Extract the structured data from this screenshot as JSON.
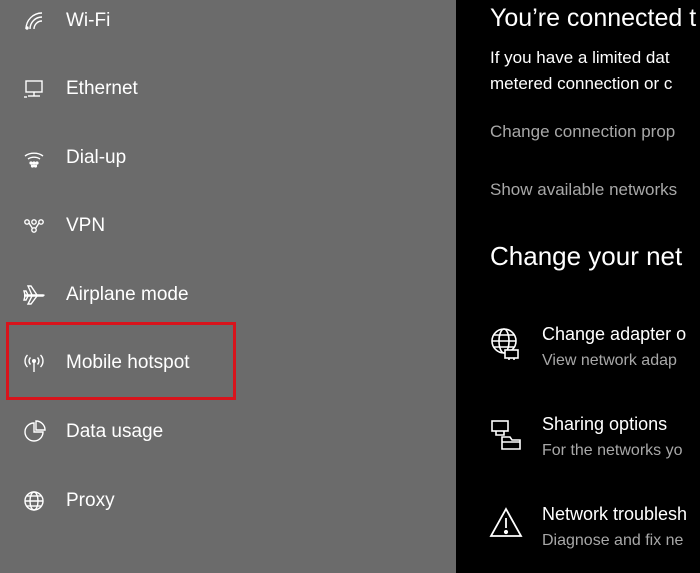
{
  "sidebar": {
    "items": [
      {
        "label": "Wi-Fi",
        "icon": "wifi-icon"
      },
      {
        "label": "Ethernet",
        "icon": "ethernet-icon"
      },
      {
        "label": "Dial-up",
        "icon": "dial-up-icon"
      },
      {
        "label": "VPN",
        "icon": "vpn-icon"
      },
      {
        "label": "Airplane mode",
        "icon": "airplane-icon"
      },
      {
        "label": "Mobile hotspot",
        "icon": "hotspot-icon",
        "highlighted": true
      },
      {
        "label": "Data usage",
        "icon": "data-usage-icon"
      },
      {
        "label": "Proxy",
        "icon": "globe-icon"
      }
    ]
  },
  "main": {
    "connected_title": "You’re connected t",
    "connected_desc_1": "If you have a limited dat",
    "connected_desc_2": "metered connection or c",
    "change_props_link": "Change connection prop",
    "show_networks_link": "Show available networks",
    "section_title": "Change your net",
    "options": [
      {
        "title": "Change adapter o",
        "desc": "View network adap",
        "icon": "adapter-globe-icon"
      },
      {
        "title": "Sharing options",
        "desc": "For the networks yo",
        "icon": "sharing-icon"
      },
      {
        "title": "Network troublesh",
        "desc": "Diagnose and fix ne",
        "icon": "warning-icon"
      }
    ]
  },
  "colors": {
    "sidebar_bg": "#6b6b6b",
    "main_bg": "#000000",
    "highlight": "#d8141c",
    "link": "#a8a8a8"
  }
}
